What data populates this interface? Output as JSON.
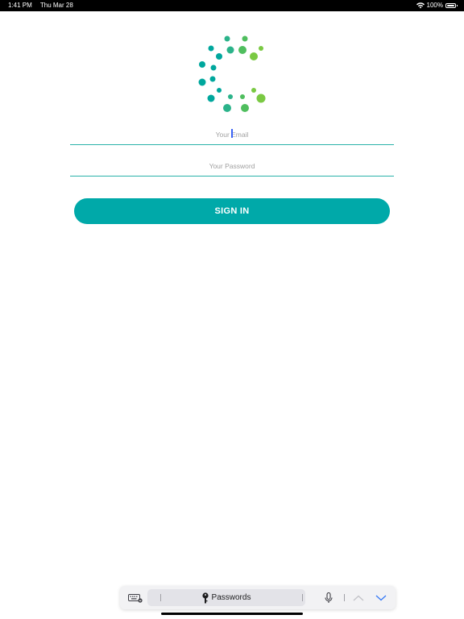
{
  "status_bar": {
    "time": "1:41 PM",
    "date": "Thu Mar 28",
    "battery": "100%",
    "wifi_icon": "wifi-icon",
    "battery_icon": "battery-icon"
  },
  "logo": {
    "icon": "dotted-c-logo",
    "colors": [
      "#00a79d",
      "#2bb38a",
      "#4fbe5e",
      "#7ac943"
    ]
  },
  "login": {
    "email_placeholder": "Your Email",
    "email_value": "",
    "password_placeholder": "Your Password",
    "password_value": "",
    "sign_in_label": "SIGN IN"
  },
  "accessory_bar": {
    "passwords_label": "Passwords",
    "icons": [
      "keyboard-icon",
      "key-icon",
      "microphone-icon",
      "chevron-up-icon",
      "chevron-down-icon"
    ]
  },
  "colors": {
    "accent": "#00a9a9",
    "field_line": "#2bb3aa",
    "caret": "#3b63f5",
    "nav_active": "#3478f6"
  }
}
